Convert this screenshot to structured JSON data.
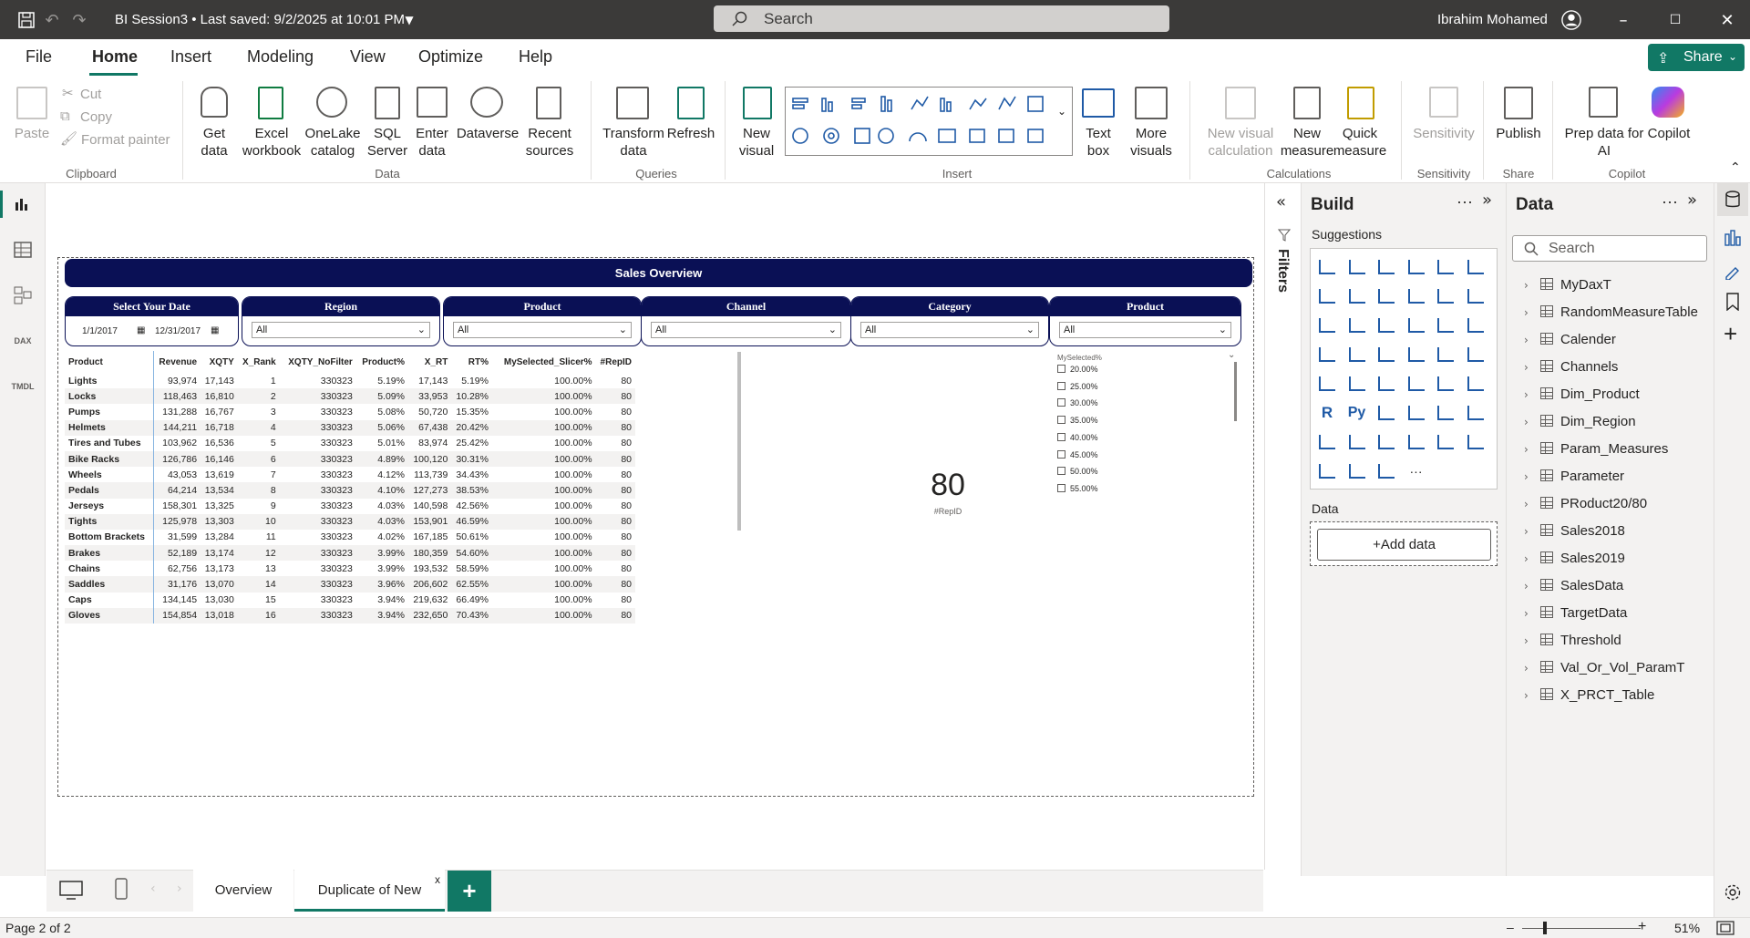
{
  "titlebar": {
    "file_title": "BI Session3 • Last saved: 9/2/2025 at 10:01 PM",
    "search_placeholder": "Search",
    "user_name": "Ibrahim Mohamed"
  },
  "menu": [
    "File",
    "Home",
    "Insert",
    "Modeling",
    "View",
    "Optimize",
    "Help"
  ],
  "share_label": "Share",
  "ribbon": {
    "clipboard": {
      "paste": "Paste",
      "cut": "Cut",
      "copy": "Copy",
      "format_painter": "Format painter",
      "group": "Clipboard"
    },
    "data": {
      "get_data": "Get data",
      "excel": "Excel workbook",
      "onelake": "OneLake catalog",
      "sql": "SQL Server",
      "enter": "Enter data",
      "dataverse": "Dataverse",
      "recent": "Recent sources",
      "group": "Data"
    },
    "queries": {
      "transform": "Transform data",
      "refresh": "Refresh",
      "group": "Queries"
    },
    "insert": {
      "new_visual": "New visual",
      "text_box": "Text box",
      "more_visuals": "More visuals",
      "group": "Insert"
    },
    "calculations": {
      "new_visual_calc": "New visual calculation",
      "new_measure": "New measure",
      "quick_measure": "Quick measure",
      "group": "Calculations"
    },
    "sensitivity": {
      "label": "Sensitivity",
      "group": "Sensitivity"
    },
    "share": {
      "publish": "Publish",
      "group": "Share"
    },
    "copilot": {
      "prep": "Prep data for AI",
      "copilot": "Copilot",
      "group": "Copilot"
    }
  },
  "report": {
    "header": "Sales Overview",
    "slicers": [
      {
        "title": "Select Your Date",
        "from": "1/1/2017",
        "to": "12/31/2017"
      },
      {
        "title": "Region",
        "value": "All"
      },
      {
        "title": "Product",
        "value": "All"
      },
      {
        "title": "Channel",
        "value": "All"
      },
      {
        "title": "Category",
        "value": "All"
      },
      {
        "title": "Product",
        "value": "All"
      }
    ],
    "table": {
      "columns": [
        "Product",
        "Revenue",
        "XQTY",
        "X_Rank",
        "XQTY_NoFilter",
        "Product%",
        "X_RT",
        "RT%",
        "MySelected_Slicer%",
        "#RepID"
      ],
      "rows": [
        [
          "Lights",
          "93,974",
          "17,143",
          "1",
          "330323",
          "5.19%",
          "17,143",
          "5.19%",
          "100.00%",
          "80"
        ],
        [
          "Locks",
          "118,463",
          "16,810",
          "2",
          "330323",
          "5.09%",
          "33,953",
          "10.28%",
          "100.00%",
          "80"
        ],
        [
          "Pumps",
          "131,288",
          "16,767",
          "3",
          "330323",
          "5.08%",
          "50,720",
          "15.35%",
          "100.00%",
          "80"
        ],
        [
          "Helmets",
          "144,211",
          "16,718",
          "4",
          "330323",
          "5.06%",
          "67,438",
          "20.42%",
          "100.00%",
          "80"
        ],
        [
          "Tires and Tubes",
          "103,962",
          "16,536",
          "5",
          "330323",
          "5.01%",
          "83,974",
          "25.42%",
          "100.00%",
          "80"
        ],
        [
          "Bike Racks",
          "126,786",
          "16,146",
          "6",
          "330323",
          "4.89%",
          "100,120",
          "30.31%",
          "100.00%",
          "80"
        ],
        [
          "Wheels",
          "43,053",
          "13,619",
          "7",
          "330323",
          "4.12%",
          "113,739",
          "34.43%",
          "100.00%",
          "80"
        ],
        [
          "Pedals",
          "64,214",
          "13,534",
          "8",
          "330323",
          "4.10%",
          "127,273",
          "38.53%",
          "100.00%",
          "80"
        ],
        [
          "Jerseys",
          "158,301",
          "13,325",
          "9",
          "330323",
          "4.03%",
          "140,598",
          "42.56%",
          "100.00%",
          "80"
        ],
        [
          "Tights",
          "125,978",
          "13,303",
          "10",
          "330323",
          "4.03%",
          "153,901",
          "46.59%",
          "100.00%",
          "80"
        ],
        [
          "Bottom Brackets",
          "31,599",
          "13,284",
          "11",
          "330323",
          "4.02%",
          "167,185",
          "50.61%",
          "100.00%",
          "80"
        ],
        [
          "Brakes",
          "52,189",
          "13,174",
          "12",
          "330323",
          "3.99%",
          "180,359",
          "54.60%",
          "100.00%",
          "80"
        ],
        [
          "Chains",
          "62,756",
          "13,173",
          "13",
          "330323",
          "3.99%",
          "193,532",
          "58.59%",
          "100.00%",
          "80"
        ],
        [
          "Saddles",
          "31,176",
          "13,070",
          "14",
          "330323",
          "3.96%",
          "206,602",
          "62.55%",
          "100.00%",
          "80"
        ],
        [
          "Caps",
          "134,145",
          "13,030",
          "15",
          "330323",
          "3.94%",
          "219,632",
          "66.49%",
          "100.00%",
          "80"
        ],
        [
          "Gloves",
          "154,854",
          "13,018",
          "16",
          "330323",
          "3.94%",
          "232,650",
          "70.43%",
          "100.00%",
          "80"
        ]
      ]
    },
    "kpi": {
      "value": "80",
      "label": "#RepID"
    },
    "pct_slicer": {
      "title": "MySelected%",
      "options": [
        "20.00%",
        "25.00%",
        "30.00%",
        "35.00%",
        "40.00%",
        "45.00%",
        "50.00%",
        "55.00%"
      ]
    }
  },
  "filters_label": "Filters",
  "build": {
    "title": "Build",
    "suggestions": "Suggestions",
    "data_label": "Data",
    "add_data": "+Add data"
  },
  "data_pane": {
    "title": "Data",
    "search_placeholder": "Search",
    "tables": [
      "MyDaxT",
      "RandomMeasureTable",
      "Calender",
      "Channels",
      "Dim_Product",
      "Dim_Region",
      "Param_Measures",
      "Parameter",
      "PRoduct20/80",
      "Sales2018",
      "Sales2019",
      "SalesData",
      "TargetData",
      "Threshold",
      "Val_Or_Vol_ParamT",
      "X_PRCT_Table"
    ]
  },
  "pages": [
    "Overview",
    "Duplicate of New"
  ],
  "status": {
    "page": "Page 2 of 2",
    "zoom": "51%"
  },
  "colors": {
    "header_navy": "#0a1055",
    "share_green": "#117865",
    "titlebar": "#3b3a39"
  }
}
